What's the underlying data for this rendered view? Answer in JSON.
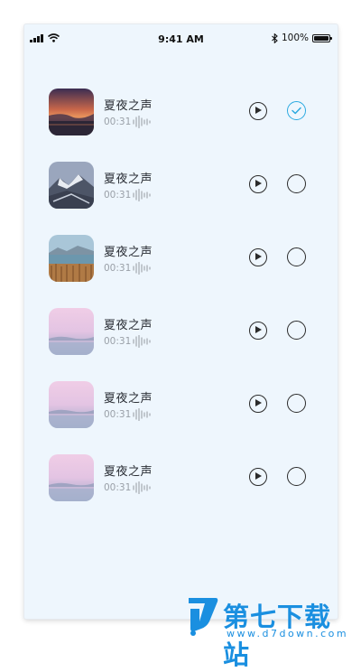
{
  "status_bar": {
    "time": "9:41 AM",
    "battery": "100%"
  },
  "list": {
    "items": [
      {
        "title": "夏夜之声",
        "duration": "00:31",
        "selected": true,
        "thumb": "sunset-lake"
      },
      {
        "title": "夏夜之声",
        "duration": "00:31",
        "selected": false,
        "thumb": "snowy-mountains"
      },
      {
        "title": "夏夜之声",
        "duration": "00:31",
        "selected": false,
        "thumb": "lake-reeds"
      },
      {
        "title": "夏夜之声",
        "duration": "00:31",
        "selected": false,
        "thumb": "pink-mist"
      },
      {
        "title": "夏夜之声",
        "duration": "00:31",
        "selected": false,
        "thumb": "pink-mist"
      },
      {
        "title": "夏夜之声",
        "duration": "00:31",
        "selected": false,
        "thumb": "pink-mist"
      }
    ]
  },
  "watermark": {
    "brand": "第七下载站",
    "url": "www.d7down.com"
  },
  "colors": {
    "background": "#eef6fd",
    "check_accent": "#2aa9e0",
    "watermark": "#1a8fe0"
  }
}
